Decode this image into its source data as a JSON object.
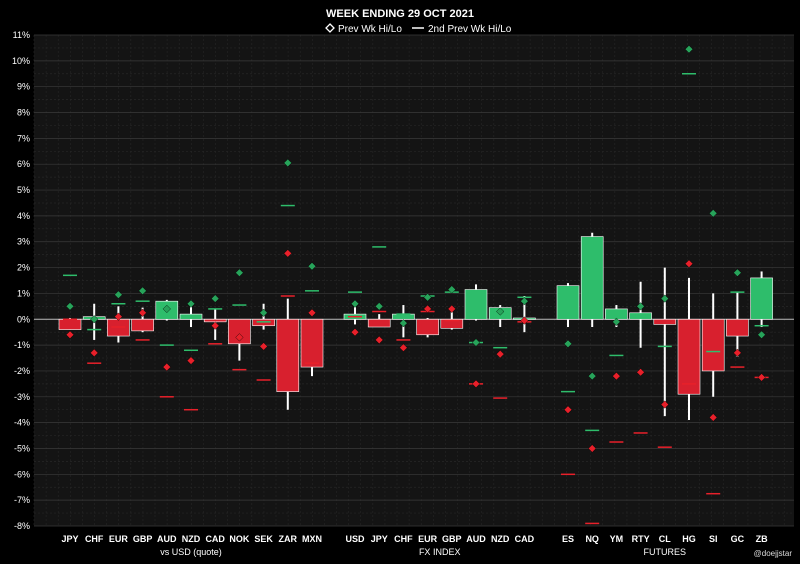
{
  "chart_data": {
    "type": "candlestick",
    "title": "WEEK ENDING  29 OCT 2021",
    "legend": [
      {
        "marker": "diamond",
        "label": "Prev Wk Hi/Lo"
      },
      {
        "marker": "line",
        "label": "2nd Prev Wk Hi/Lo"
      }
    ],
    "legend_placement": "top-center",
    "ylim": [
      -8,
      11
    ],
    "y_ticks": [
      "-8%",
      "-7%",
      "-6%",
      "-5%",
      "-4%",
      "-3%",
      "-2%",
      "-1%",
      "0%",
      "1%",
      "2%",
      "3%",
      "4%",
      "5%",
      "6%",
      "7%",
      "8%",
      "9%",
      "10%",
      "11%"
    ],
    "grid": true,
    "groups": [
      {
        "label": "vs USD (quote)",
        "items": [
          {
            "name": "JPY",
            "open": 0,
            "close": -0.4,
            "high": 0.05,
            "low": -0.4,
            "prev_hi": 0.5,
            "prev_lo": -0.6,
            "prev2_hi": 1.7,
            "prev2_lo": 0
          },
          {
            "name": "CHF",
            "open": 0,
            "close": 0.1,
            "high": 0.6,
            "low": -0.8,
            "prev_hi": 0,
            "prev_lo": -1.3,
            "prev2_hi": -0.4,
            "prev2_lo": -1.7
          },
          {
            "name": "EUR",
            "open": 0,
            "close": -0.65,
            "high": 0.5,
            "low": -0.9,
            "prev_hi": 0.95,
            "prev_lo": 0.1,
            "prev2_hi": 0.6,
            "prev2_lo": -0.3
          },
          {
            "name": "GBP",
            "open": 0,
            "close": -0.45,
            "high": 0.45,
            "low": -0.5,
            "prev_hi": 1.1,
            "prev_lo": 0.25,
            "prev2_hi": 0.7,
            "prev2_lo": -0.8
          },
          {
            "name": "AUD",
            "open": 0,
            "close": 0.7,
            "high": 0.75,
            "low": -0.05,
            "prev_hi": 0.4,
            "prev_lo": -1.85,
            "prev2_hi": -1.0,
            "prev2_lo": -3.0
          },
          {
            "name": "NZD",
            "open": 0,
            "close": 0.2,
            "high": 0.5,
            "low": -0.3,
            "prev_hi": 0.6,
            "prev_lo": -1.6,
            "prev2_hi": -1.2,
            "prev2_lo": -3.5
          },
          {
            "name": "CAD",
            "open": 0,
            "close": -0.1,
            "high": 0.4,
            "low": -0.8,
            "prev_hi": 0.8,
            "prev_lo": -0.25,
            "prev2_hi": 0.4,
            "prev2_lo": -0.95
          },
          {
            "name": "NOK",
            "open": 0,
            "close": -0.95,
            "high": 0,
            "low": -1.6,
            "prev_hi": 1.8,
            "prev_lo": -0.7,
            "prev2_hi": 0.55,
            "prev2_lo": -1.95
          },
          {
            "name": "SEK",
            "open": 0,
            "close": -0.25,
            "high": 0.6,
            "low": -0.4,
            "prev_hi": 0.25,
            "prev_lo": -1.05,
            "prev2_hi": -0.1,
            "prev2_lo": -2.35
          },
          {
            "name": "ZAR",
            "open": 0,
            "close": -2.8,
            "high": 0.8,
            "low": -3.5,
            "prev_hi": 6.05,
            "prev_lo": 2.55,
            "prev2_hi": 4.4,
            "prev2_lo": 0.9
          },
          {
            "name": "MXN",
            "open": 0,
            "close": -1.85,
            "high": 0,
            "low": -2.2,
            "prev_hi": 2.05,
            "prev_lo": 0.25,
            "prev2_hi": 1.1,
            "prev2_lo": -1.7
          }
        ]
      },
      {
        "label": "FX INDEX",
        "items": [
          {
            "name": "USD",
            "open": 0,
            "close": 0.2,
            "high": 0.5,
            "low": -0.2,
            "prev_hi": 0.6,
            "prev_lo": -0.5,
            "prev2_hi": 1.05,
            "prev2_lo": 0.1
          },
          {
            "name": "JPY",
            "open": 0,
            "close": -0.3,
            "high": 0.2,
            "low": -0.3,
            "prev_hi": 0.5,
            "prev_lo": -0.8,
            "prev2_hi": 2.8,
            "prev2_lo": 0.3
          },
          {
            "name": "CHF",
            "open": 0,
            "close": 0.2,
            "high": 0.55,
            "low": -0.7,
            "prev_hi": -0.15,
            "prev_lo": -1.1,
            "prev2_hi": 0.2,
            "prev2_lo": -0.8
          },
          {
            "name": "EUR",
            "open": 0,
            "close": -0.6,
            "high": 0.05,
            "low": -0.7,
            "prev_hi": 0.85,
            "prev_lo": 0.4,
            "prev2_hi": 0.9,
            "prev2_lo": 0.3
          },
          {
            "name": "GBP",
            "open": 0,
            "close": -0.35,
            "high": 0.4,
            "low": -0.4,
            "prev_hi": 1.15,
            "prev_lo": 0.4,
            "prev2_hi": 1.05,
            "prev2_lo": -0.05
          },
          {
            "name": "AUD",
            "open": 0,
            "close": 1.15,
            "high": 1.35,
            "low": -0.05,
            "prev_hi": -0.9,
            "prev_lo": -2.5,
            "prev2_hi": -0.9,
            "prev2_lo": -2.5
          },
          {
            "name": "NZD",
            "open": 0,
            "close": 0.45,
            "high": 0.55,
            "low": -0.3,
            "prev_hi": 0.3,
            "prev_lo": -1.35,
            "prev2_hi": -1.1,
            "prev2_lo": -3.05
          },
          {
            "name": "CAD",
            "open": 0,
            "close": 0.05,
            "high": 0.9,
            "low": -0.5,
            "prev_hi": 0.7,
            "prev_lo": -0.05,
            "prev2_hi": 0.85,
            "prev2_lo": -0.1
          }
        ]
      },
      {
        "label": "FUTURES",
        "items": [
          {
            "name": "ES",
            "open": 0,
            "close": 1.3,
            "high": 1.4,
            "low": -0.3,
            "prev_hi": -0.95,
            "prev_lo": -3.5,
            "prev2_hi": -2.8,
            "prev2_lo": -6.0
          },
          {
            "name": "NQ",
            "open": 0,
            "close": 3.2,
            "high": 3.35,
            "low": -0.3,
            "prev_hi": -2.2,
            "prev_lo": -5.0,
            "prev2_hi": -4.3,
            "prev2_lo": -7.9
          },
          {
            "name": "YM",
            "open": 0,
            "close": 0.4,
            "high": 0.55,
            "low": -0.3,
            "prev_hi": -0.1,
            "prev_lo": -2.2,
            "prev2_hi": -1.4,
            "prev2_lo": -4.75
          },
          {
            "name": "RTY",
            "open": 0,
            "close": 0.25,
            "high": 1.45,
            "low": -1.1,
            "prev_hi": 0.5,
            "prev_lo": -2.05,
            "prev2_hi": 0.1,
            "prev2_lo": -4.4
          },
          {
            "name": "CL",
            "open": 0,
            "close": -0.2,
            "high": 2.0,
            "low": -3.75,
            "prev_hi": 0.8,
            "prev_lo": -3.3,
            "prev2_hi": -1.05,
            "prev2_lo": -4.95
          },
          {
            "name": "HG",
            "open": 0,
            "close": -2.9,
            "high": 1.6,
            "low": -3.9,
            "prev_hi": 10.45,
            "prev_lo": 2.15,
            "prev2_hi": 9.5,
            "prev2_lo": -2.5
          },
          {
            "name": "SI",
            "open": 0,
            "close": -2.0,
            "high": 1.0,
            "low": -3.0,
            "prev_hi": 4.1,
            "prev_lo": -3.8,
            "prev2_hi": -1.25,
            "prev2_lo": -6.75
          },
          {
            "name": "GC",
            "open": 0,
            "close": -0.65,
            "high": 1.05,
            "low": -1.45,
            "prev_hi": 1.8,
            "prev_lo": -1.3,
            "prev2_hi": 1.05,
            "prev2_lo": -1.85
          },
          {
            "name": "ZB",
            "open": 0,
            "close": 1.6,
            "high": 1.85,
            "low": -0.3,
            "prev_hi": -0.6,
            "prev_lo": -2.25,
            "prev2_hi": -0.25,
            "prev2_lo": -2.25
          }
        ]
      }
    ],
    "colors": {
      "up": "#2ebd6b",
      "down": "#d8202e",
      "wick": "#ffffff",
      "prev_hi": "#27a35a",
      "prev_lo": "#e8202a",
      "prev2_hi": "#2ebd6b",
      "prev2_lo": "#e8202a",
      "grid": "#3a3a3a",
      "background": "#000000",
      "plot_background": "#141414"
    },
    "credit": "@doejjstar"
  }
}
